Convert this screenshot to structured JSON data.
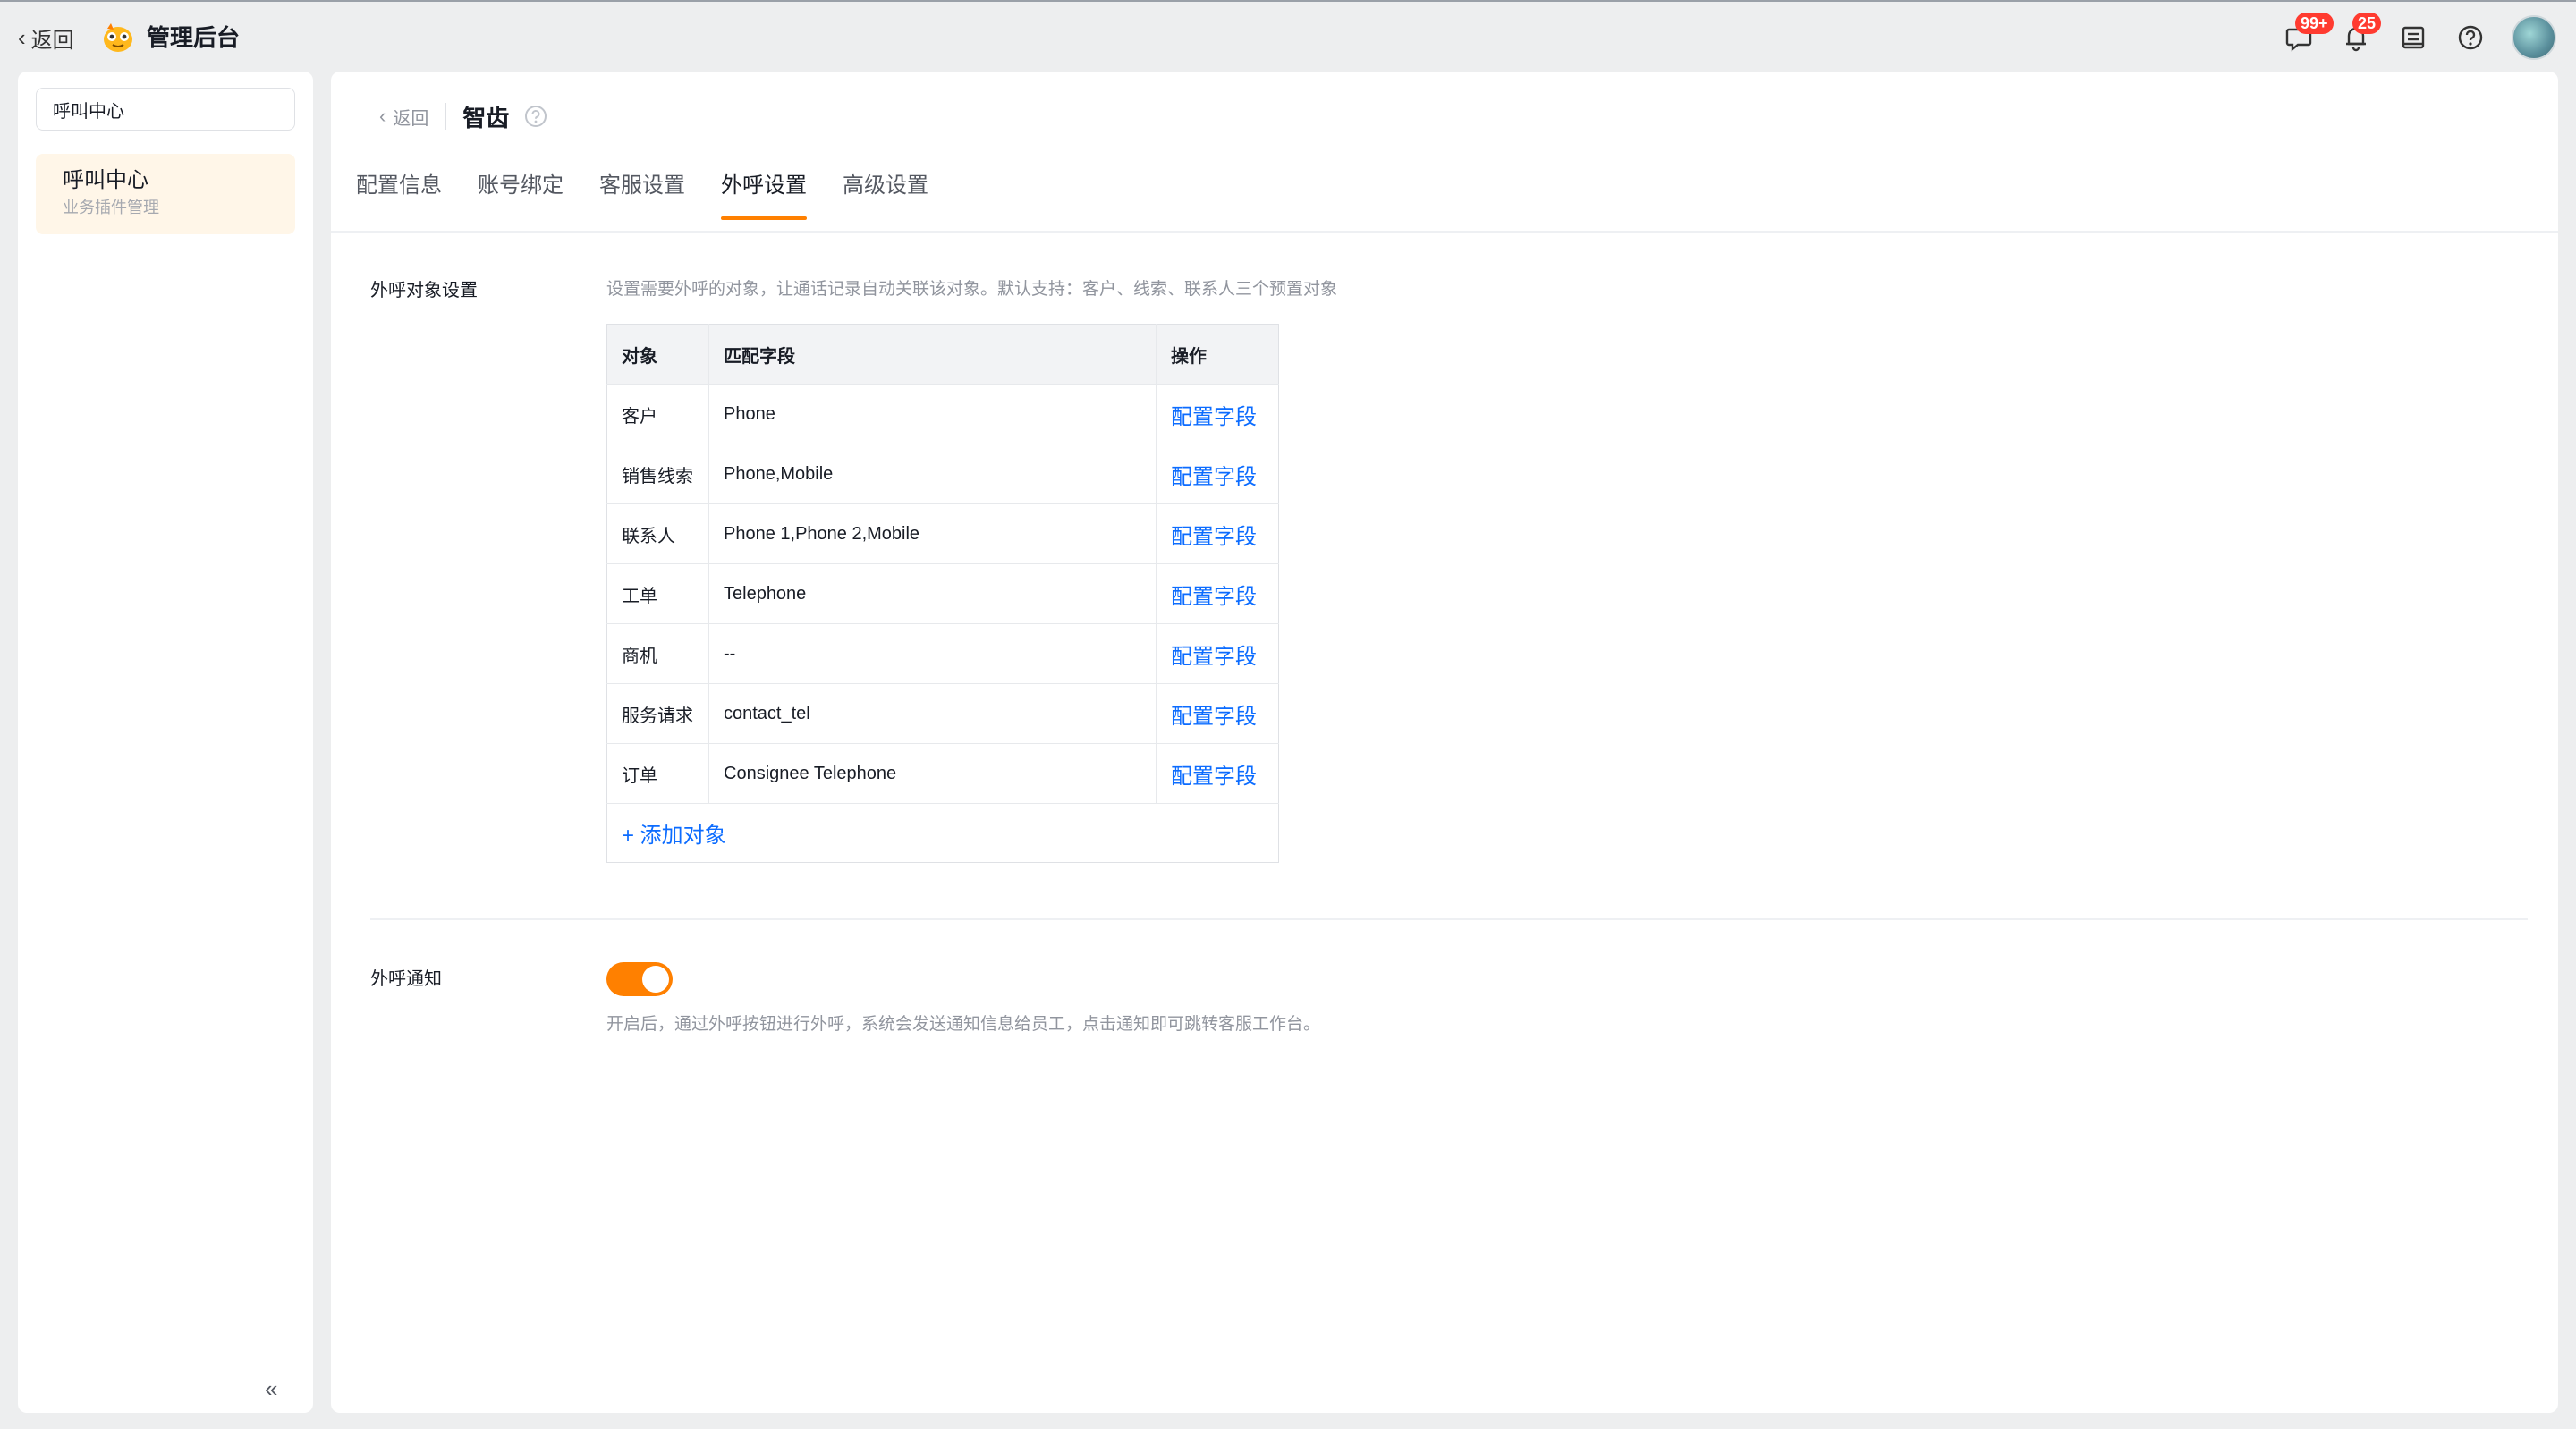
{
  "topbar": {
    "back_label": "返回",
    "app_title": "管理后台",
    "messages_badge": "99+",
    "notifications_badge": "25"
  },
  "sidebar": {
    "search_value": "呼叫中心",
    "item_title": "呼叫中心",
    "item_subtitle": "业务插件管理"
  },
  "main": {
    "back_label": "返回",
    "plugin_title": "智齿",
    "tabs": [
      {
        "label": "配置信息"
      },
      {
        "label": "账号绑定"
      },
      {
        "label": "客服设置"
      },
      {
        "label": "外呼设置",
        "active": true
      },
      {
        "label": "高级设置"
      }
    ],
    "outbound_object": {
      "label": "外呼对象设置",
      "description": "设置需要外呼的对象，让通话记录自动关联该对象。默认支持：客户、线索、联系人三个预置对象",
      "columns": [
        "对象",
        "匹配字段",
        "操作"
      ],
      "rows": [
        {
          "object": "客户",
          "field": "Phone",
          "action": "配置字段"
        },
        {
          "object": "销售线索",
          "field": "Phone,Mobile",
          "action": "配置字段"
        },
        {
          "object": "联系人",
          "field": "Phone 1,Phone 2,Mobile",
          "action": "配置字段"
        },
        {
          "object": "工单",
          "field": "Telephone",
          "action": "配置字段"
        },
        {
          "object": "商机",
          "field": "--",
          "action": "配置字段"
        },
        {
          "object": "服务请求",
          "field": "contact_tel",
          "action": "配置字段"
        },
        {
          "object": "订单",
          "field": "Consignee Telephone",
          "action": "配置字段"
        }
      ],
      "add_label": "+ 添加对象"
    },
    "outbound_notify": {
      "label": "外呼通知",
      "enabled": true,
      "description": "开启后，通过外呼按钮进行外呼，系统会发送通知信息给员工，点击通知即可跳转客服工作台。"
    }
  },
  "colors": {
    "accent": "#ff8000",
    "link": "#0c6cff",
    "badge": "#ff3b30",
    "selected_bg": "#fff6e8"
  },
  "icons": [
    "back-chevron-icon",
    "app-logo-icon",
    "chat-icon",
    "bell-icon",
    "todo-icon",
    "help-icon",
    "search-icon",
    "clear-icon",
    "collapse-icon"
  ]
}
